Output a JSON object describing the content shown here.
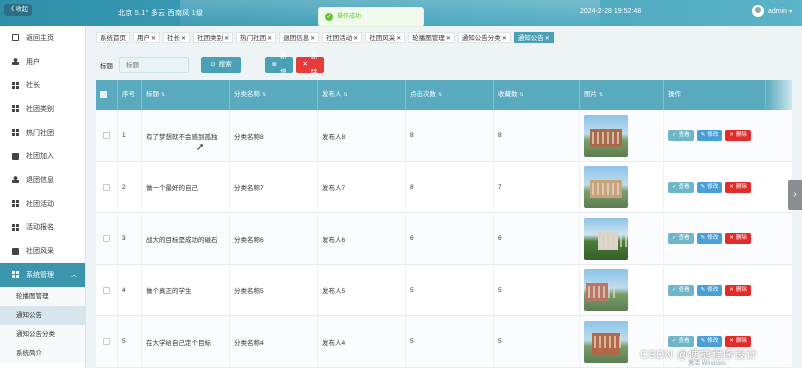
{
  "header": {
    "collapse_label": "《 收起",
    "weather": "北京  5.1°  多云  西南风  1级",
    "toast": "操作成功",
    "datetime": "2024-2-28  19:52:48",
    "user": "admin"
  },
  "sidebar": {
    "items": [
      {
        "label": "返回主页",
        "icon": "home-icon"
      },
      {
        "label": "用户",
        "icon": "user-icon"
      },
      {
        "label": "社长",
        "icon": "grid-icon"
      },
      {
        "label": "社团类别",
        "icon": "grid-icon"
      },
      {
        "label": "热门社团",
        "icon": "grid-icon"
      },
      {
        "label": "社团加入",
        "icon": "box-icon"
      },
      {
        "label": "退团信息",
        "icon": "user-icon"
      },
      {
        "label": "社团活动",
        "icon": "grid-icon"
      },
      {
        "label": "活动报名",
        "icon": "grid-icon"
      },
      {
        "label": "社团风采",
        "icon": "box-icon"
      }
    ],
    "group": {
      "label": "系统管理",
      "expanded": true
    },
    "sub_items": [
      "轮播图管理",
      "通知公告",
      "通知公告分类",
      "系统简介"
    ],
    "active_sub": "通知公告"
  },
  "tabs": [
    {
      "label": "系统首页",
      "closable": false
    },
    {
      "label": "用户",
      "closable": true
    },
    {
      "label": "社长",
      "closable": true
    },
    {
      "label": "社团类别",
      "closable": true
    },
    {
      "label": "热门社团",
      "closable": true
    },
    {
      "label": "退团信息",
      "closable": true
    },
    {
      "label": "社团活动",
      "closable": true
    },
    {
      "label": "社团风采",
      "closable": true
    },
    {
      "label": "轮播图管理",
      "closable": true
    },
    {
      "label": "通知公告分类",
      "closable": true
    },
    {
      "label": "通知公告",
      "closable": true,
      "active": true
    }
  ],
  "search": {
    "label": "标题",
    "placeholder": "标题",
    "search_button": "搜索",
    "add_button": "新增",
    "delete_button": "删除"
  },
  "table": {
    "columns": [
      "",
      "序号",
      "标题",
      "分类名称",
      "发布人",
      "点击次数",
      "收藏数",
      "图片",
      "操作"
    ],
    "rows": [
      {
        "no": "1",
        "title": "有了梦想就不会感到孤独",
        "category": "分类名称8",
        "publisher": "发布人8",
        "clicks": "8",
        "favorites": "8"
      },
      {
        "no": "2",
        "title": "做一个最好的自己",
        "category": "分类名称7",
        "publisher": "发布人7",
        "clicks": "8",
        "favorites": "7"
      },
      {
        "no": "3",
        "title": "战大的目标是成功的磁石",
        "category": "分类名称6",
        "publisher": "发布人6",
        "clicks": "6",
        "favorites": "6"
      },
      {
        "no": "4",
        "title": "做个真正的学生",
        "category": "分类名称5",
        "publisher": "发布人5",
        "clicks": "5",
        "favorites": "5"
      },
      {
        "no": "5",
        "title": "在大学给自己定个目标",
        "category": "分类名称4",
        "publisher": "发布人4",
        "clicks": "5",
        "favorites": "5"
      }
    ],
    "actions": {
      "view": "查看",
      "edit": "修改",
      "delete": "删除"
    }
  },
  "watermark": "CSDN @便捷程序设计",
  "watermark_sub": "激活 Windows",
  "colors": {
    "accent": "#4aa0b5",
    "danger": "#e63b3b",
    "edit": "#4a9fd6"
  }
}
